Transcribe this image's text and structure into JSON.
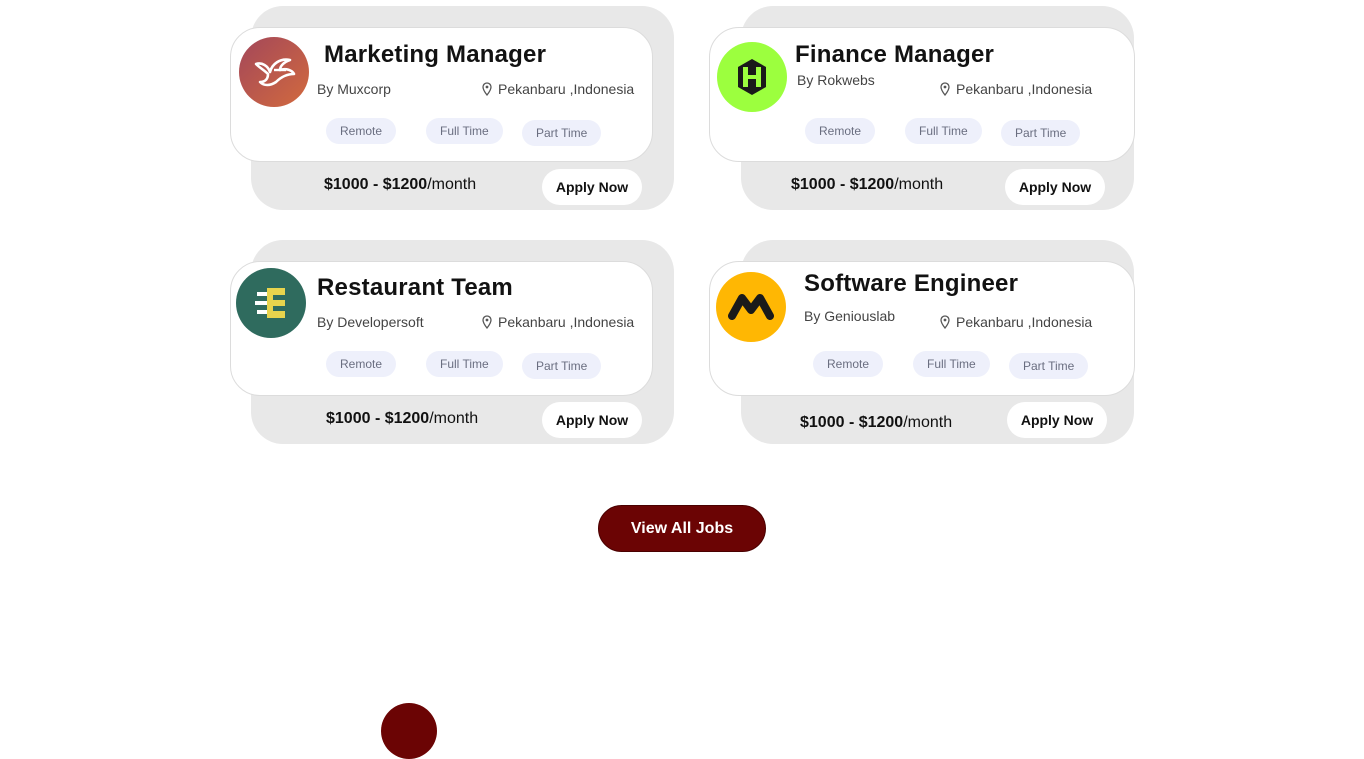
{
  "jobs": [
    {
      "title": "Marketing Manager",
      "company": "By Muxcorp",
      "location": "Pekanbaru ,Indonesia",
      "tags": [
        "Remote",
        "Full Time",
        "Part Time"
      ],
      "salary_range": "$1000 - $1200",
      "salary_unit": "/month",
      "apply_label": "Apply Now",
      "logo_icon": "bird-logo-icon"
    },
    {
      "title": "Finance Manager",
      "company": "By Rokwebs",
      "location": "Pekanbaru ,Indonesia",
      "tags": [
        "Remote",
        "Full Time",
        "Part Time"
      ],
      "salary_range": "$1000 - $1200",
      "salary_unit": "/month",
      "apply_label": "Apply Now",
      "logo_icon": "hexagon-logo-icon"
    },
    {
      "title": "Restaurant Team",
      "company": "By Developersoft",
      "location": "Pekanbaru ,Indonesia",
      "tags": [
        "Remote",
        "Full Time",
        "Part Time"
      ],
      "salary_range": "$1000 - $1200",
      "salary_unit": "/month",
      "apply_label": "Apply Now",
      "logo_icon": "e-letter-logo-icon"
    },
    {
      "title": "Software Engineer",
      "company": "By Geniouslab",
      "location": "Pekanbaru ,Indonesia",
      "tags": [
        "Remote",
        "Full Time",
        "Part Time"
      ],
      "salary_range": "$1000 - $1200",
      "salary_unit": "/month",
      "apply_label": "Apply Now",
      "logo_icon": "m-shape-logo-icon"
    }
  ],
  "view_all_label": "View All Jobs",
  "colors": {
    "accent": "#6b0404",
    "card_back": "#e8e8e8",
    "tag_bg": "#eef0fb",
    "logo_muxcorp": "#b0504a",
    "logo_rokwebs": "#9cff3e",
    "logo_developersoft": "#2f6b5e",
    "logo_geniouslab": "#ffb703"
  }
}
